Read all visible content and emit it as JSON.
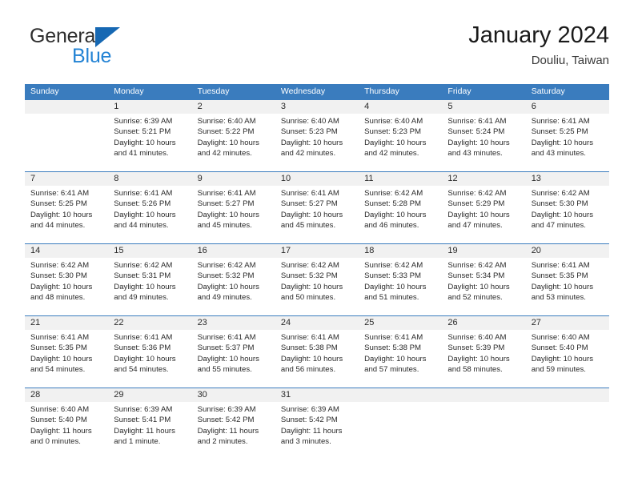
{
  "brand": {
    "name_top": "General",
    "name_bottom": "Blue",
    "triangle_color": "#1668b3",
    "blue_color": "#2383d4"
  },
  "header": {
    "title": "January 2024",
    "subtitle": "Douliu, Taiwan"
  },
  "theme": {
    "header_blue": "#3a7cbe",
    "day_band_gray": "#f1f1f1",
    "text": "#2a2a2a"
  },
  "weekdays": [
    "Sunday",
    "Monday",
    "Tuesday",
    "Wednesday",
    "Thursday",
    "Friday",
    "Saturday"
  ],
  "weeks": [
    {
      "days": [
        {
          "num": "",
          "sunrise": "",
          "sunset": "",
          "daylight1": "",
          "daylight2": ""
        },
        {
          "num": "1",
          "sunrise": "Sunrise: 6:39 AM",
          "sunset": "Sunset: 5:21 PM",
          "daylight1": "Daylight: 10 hours",
          "daylight2": "and 41 minutes."
        },
        {
          "num": "2",
          "sunrise": "Sunrise: 6:40 AM",
          "sunset": "Sunset: 5:22 PM",
          "daylight1": "Daylight: 10 hours",
          "daylight2": "and 42 minutes."
        },
        {
          "num": "3",
          "sunrise": "Sunrise: 6:40 AM",
          "sunset": "Sunset: 5:23 PM",
          "daylight1": "Daylight: 10 hours",
          "daylight2": "and 42 minutes."
        },
        {
          "num": "4",
          "sunrise": "Sunrise: 6:40 AM",
          "sunset": "Sunset: 5:23 PM",
          "daylight1": "Daylight: 10 hours",
          "daylight2": "and 42 minutes."
        },
        {
          "num": "5",
          "sunrise": "Sunrise: 6:41 AM",
          "sunset": "Sunset: 5:24 PM",
          "daylight1": "Daylight: 10 hours",
          "daylight2": "and 43 minutes."
        },
        {
          "num": "6",
          "sunrise": "Sunrise: 6:41 AM",
          "sunset": "Sunset: 5:25 PM",
          "daylight1": "Daylight: 10 hours",
          "daylight2": "and 43 minutes."
        }
      ]
    },
    {
      "days": [
        {
          "num": "7",
          "sunrise": "Sunrise: 6:41 AM",
          "sunset": "Sunset: 5:25 PM",
          "daylight1": "Daylight: 10 hours",
          "daylight2": "and 44 minutes."
        },
        {
          "num": "8",
          "sunrise": "Sunrise: 6:41 AM",
          "sunset": "Sunset: 5:26 PM",
          "daylight1": "Daylight: 10 hours",
          "daylight2": "and 44 minutes."
        },
        {
          "num": "9",
          "sunrise": "Sunrise: 6:41 AM",
          "sunset": "Sunset: 5:27 PM",
          "daylight1": "Daylight: 10 hours",
          "daylight2": "and 45 minutes."
        },
        {
          "num": "10",
          "sunrise": "Sunrise: 6:41 AM",
          "sunset": "Sunset: 5:27 PM",
          "daylight1": "Daylight: 10 hours",
          "daylight2": "and 45 minutes."
        },
        {
          "num": "11",
          "sunrise": "Sunrise: 6:42 AM",
          "sunset": "Sunset: 5:28 PM",
          "daylight1": "Daylight: 10 hours",
          "daylight2": "and 46 minutes."
        },
        {
          "num": "12",
          "sunrise": "Sunrise: 6:42 AM",
          "sunset": "Sunset: 5:29 PM",
          "daylight1": "Daylight: 10 hours",
          "daylight2": "and 47 minutes."
        },
        {
          "num": "13",
          "sunrise": "Sunrise: 6:42 AM",
          "sunset": "Sunset: 5:30 PM",
          "daylight1": "Daylight: 10 hours",
          "daylight2": "and 47 minutes."
        }
      ]
    },
    {
      "days": [
        {
          "num": "14",
          "sunrise": "Sunrise: 6:42 AM",
          "sunset": "Sunset: 5:30 PM",
          "daylight1": "Daylight: 10 hours",
          "daylight2": "and 48 minutes."
        },
        {
          "num": "15",
          "sunrise": "Sunrise: 6:42 AM",
          "sunset": "Sunset: 5:31 PM",
          "daylight1": "Daylight: 10 hours",
          "daylight2": "and 49 minutes."
        },
        {
          "num": "16",
          "sunrise": "Sunrise: 6:42 AM",
          "sunset": "Sunset: 5:32 PM",
          "daylight1": "Daylight: 10 hours",
          "daylight2": "and 49 minutes."
        },
        {
          "num": "17",
          "sunrise": "Sunrise: 6:42 AM",
          "sunset": "Sunset: 5:32 PM",
          "daylight1": "Daylight: 10 hours",
          "daylight2": "and 50 minutes."
        },
        {
          "num": "18",
          "sunrise": "Sunrise: 6:42 AM",
          "sunset": "Sunset: 5:33 PM",
          "daylight1": "Daylight: 10 hours",
          "daylight2": "and 51 minutes."
        },
        {
          "num": "19",
          "sunrise": "Sunrise: 6:42 AM",
          "sunset": "Sunset: 5:34 PM",
          "daylight1": "Daylight: 10 hours",
          "daylight2": "and 52 minutes."
        },
        {
          "num": "20",
          "sunrise": "Sunrise: 6:41 AM",
          "sunset": "Sunset: 5:35 PM",
          "daylight1": "Daylight: 10 hours",
          "daylight2": "and 53 minutes."
        }
      ]
    },
    {
      "days": [
        {
          "num": "21",
          "sunrise": "Sunrise: 6:41 AM",
          "sunset": "Sunset: 5:35 PM",
          "daylight1": "Daylight: 10 hours",
          "daylight2": "and 54 minutes."
        },
        {
          "num": "22",
          "sunrise": "Sunrise: 6:41 AM",
          "sunset": "Sunset: 5:36 PM",
          "daylight1": "Daylight: 10 hours",
          "daylight2": "and 54 minutes."
        },
        {
          "num": "23",
          "sunrise": "Sunrise: 6:41 AM",
          "sunset": "Sunset: 5:37 PM",
          "daylight1": "Daylight: 10 hours",
          "daylight2": "and 55 minutes."
        },
        {
          "num": "24",
          "sunrise": "Sunrise: 6:41 AM",
          "sunset": "Sunset: 5:38 PM",
          "daylight1": "Daylight: 10 hours",
          "daylight2": "and 56 minutes."
        },
        {
          "num": "25",
          "sunrise": "Sunrise: 6:41 AM",
          "sunset": "Sunset: 5:38 PM",
          "daylight1": "Daylight: 10 hours",
          "daylight2": "and 57 minutes."
        },
        {
          "num": "26",
          "sunrise": "Sunrise: 6:40 AM",
          "sunset": "Sunset: 5:39 PM",
          "daylight1": "Daylight: 10 hours",
          "daylight2": "and 58 minutes."
        },
        {
          "num": "27",
          "sunrise": "Sunrise: 6:40 AM",
          "sunset": "Sunset: 5:40 PM",
          "daylight1": "Daylight: 10 hours",
          "daylight2": "and 59 minutes."
        }
      ]
    },
    {
      "days": [
        {
          "num": "28",
          "sunrise": "Sunrise: 6:40 AM",
          "sunset": "Sunset: 5:40 PM",
          "daylight1": "Daylight: 11 hours",
          "daylight2": "and 0 minutes."
        },
        {
          "num": "29",
          "sunrise": "Sunrise: 6:39 AM",
          "sunset": "Sunset: 5:41 PM",
          "daylight1": "Daylight: 11 hours",
          "daylight2": "and 1 minute."
        },
        {
          "num": "30",
          "sunrise": "Sunrise: 6:39 AM",
          "sunset": "Sunset: 5:42 PM",
          "daylight1": "Daylight: 11 hours",
          "daylight2": "and 2 minutes."
        },
        {
          "num": "31",
          "sunrise": "Sunrise: 6:39 AM",
          "sunset": "Sunset: 5:42 PM",
          "daylight1": "Daylight: 11 hours",
          "daylight2": "and 3 minutes."
        },
        {
          "num": "",
          "sunrise": "",
          "sunset": "",
          "daylight1": "",
          "daylight2": ""
        },
        {
          "num": "",
          "sunrise": "",
          "sunset": "",
          "daylight1": "",
          "daylight2": ""
        },
        {
          "num": "",
          "sunrise": "",
          "sunset": "",
          "daylight1": "",
          "daylight2": ""
        }
      ]
    }
  ]
}
